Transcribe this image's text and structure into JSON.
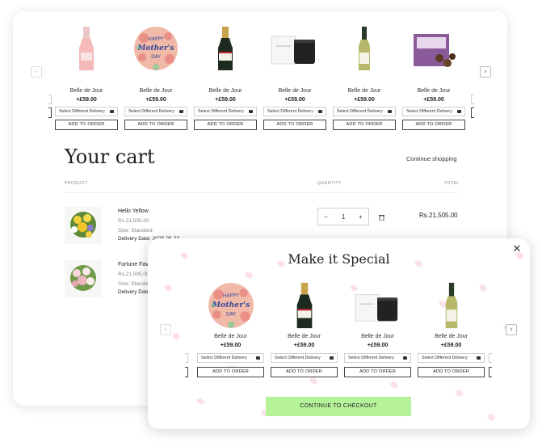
{
  "carousel_top": {
    "prev_icon": "‹",
    "next_icon": "›",
    "items": [
      {
        "name": "Belle de Jour",
        "price": "+£59.00",
        "select_label": "Select Different Delivery",
        "add_label": "ADD TO ORDER",
        "icon": "rose-champagne-bottle"
      },
      {
        "name": "Belle de Jour",
        "price": "+£59.00",
        "select_label": "Select Different Delivery",
        "add_label": "ADD TO ORDER",
        "icon": "mothers-day-balloon"
      },
      {
        "name": "Belle de Jour",
        "price": "+£59.00",
        "select_label": "Select Different Delivery",
        "add_label": "ADD TO ORDER",
        "icon": "champagne-bottle"
      },
      {
        "name": "Belle de Jour",
        "price": "+£59.00",
        "select_label": "Select Different Delivery",
        "add_label": "ADD TO ORDER",
        "icon": "candle-gift-set"
      },
      {
        "name": "Belle de Jour",
        "price": "+£59.00",
        "select_label": "Select Different Delivery",
        "add_label": "ADD TO ORDER",
        "icon": "white-wine-bottle"
      },
      {
        "name": "Belle de Jour",
        "price": "+£59.00",
        "select_label": "Select Different Delivery",
        "add_label": "ADD TO ORDER",
        "icon": "chocolate-box"
      }
    ]
  },
  "cart": {
    "title": "Your cart",
    "continue_shopping": "Continue shopping",
    "columns": {
      "product": "PRODUCT",
      "quantity": "QUANTITY",
      "total": "TOTAL"
    },
    "items": [
      {
        "name": "Hello Yellow",
        "price": "Rs.21,505.00",
        "size": "Size: Standard",
        "delivery": "Delivery Date: 2025-05-23",
        "quantity": "1",
        "total": "Rs.21,505.00"
      },
      {
        "name": "Fortune Fav",
        "price": "Rs.21,505.00",
        "size": "Size: Standa",
        "delivery": "Delivery Date:"
      }
    ],
    "qty_minus": "−",
    "qty_plus": "+"
  },
  "modal": {
    "title": "Make it Special",
    "close_icon": "✕",
    "prev_icon": "‹",
    "next_icon": "›",
    "items": [
      {
        "name": "Belle de Jour",
        "price": "+£59.00",
        "select_label": "Select Different Delivery",
        "add_label": "ADD TO ORDER",
        "icon": "mothers-day-balloon"
      },
      {
        "name": "Belle de Jour",
        "price": "+£59.00",
        "select_label": "Select Different Delivery",
        "add_label": "ADD TO ORDER",
        "icon": "champagne-bottle"
      },
      {
        "name": "Belle de Jour",
        "price": "+£59.00",
        "select_label": "Select Different Delivery",
        "add_label": "ADD TO ORDER",
        "icon": "candle-gift-set"
      },
      {
        "name": "Belle de Jour",
        "price": "+£59.00",
        "select_label": "Select Different Delivery",
        "add_label": "ADD TO ORDER",
        "icon": "white-wine-bottle"
      }
    ],
    "checkout_label": "CONTINUE TO CHECKOUT"
  },
  "balloon_text": {
    "line1": "HAPPY",
    "line2": "Mother's",
    "line3": "DAY"
  },
  "colors": {
    "checkout_bg": "#b6f29a",
    "petal": "#f7c9d3",
    "balloon_bg": "#f0b9a8",
    "balloon_text": "#3a4a9a"
  }
}
